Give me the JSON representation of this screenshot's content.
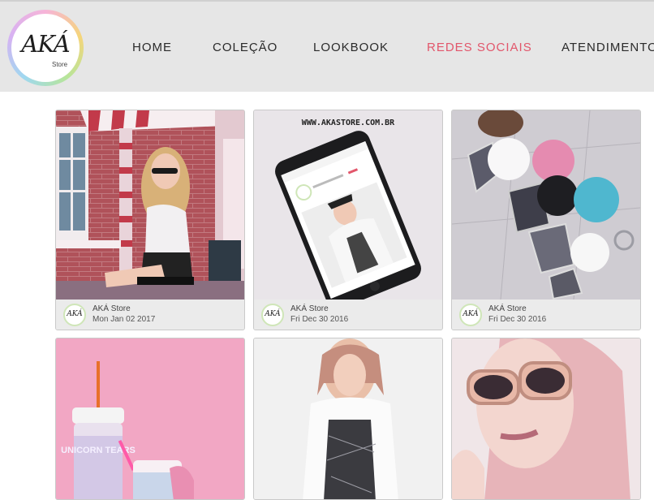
{
  "brand": {
    "logo_text": "AKÁ",
    "logo_sub": "Store"
  },
  "nav": {
    "items": [
      {
        "label": "HOME",
        "active": false
      },
      {
        "label": "COLEÇÃO",
        "active": false
      },
      {
        "label": "LOOKBOOK",
        "active": false
      },
      {
        "label": "REDES SOCIAIS",
        "active": true
      },
      {
        "label": "ATENDIMENTO",
        "active": false
      }
    ],
    "active_color": "#e2566b"
  },
  "feed": {
    "posts": [
      {
        "author": "AKÁ Store",
        "date": "Mon Jan 02 2017",
        "photo": "girl-sitting-storefront-photo"
      },
      {
        "author": "AKÁ Store",
        "date": "Fri Dec 30 2016",
        "photo": "smartphone-website-photo",
        "overlay_text": "WWW.AKASTORE.COM.BR"
      },
      {
        "author": "AKÁ Store",
        "date": "Fri Dec 30 2016",
        "photo": "keychains-pompoms-photo"
      },
      {
        "author": "",
        "date": "",
        "photo": "unicorn-tears-bottles-photo",
        "overlay_text": "UNICORN TEARS"
      },
      {
        "author": "",
        "date": "",
        "photo": "woman-graphic-tank-photo"
      },
      {
        "author": "",
        "date": "",
        "photo": "woman-pink-sunglasses-photo"
      }
    ]
  },
  "avatar_text": "AKÁ"
}
